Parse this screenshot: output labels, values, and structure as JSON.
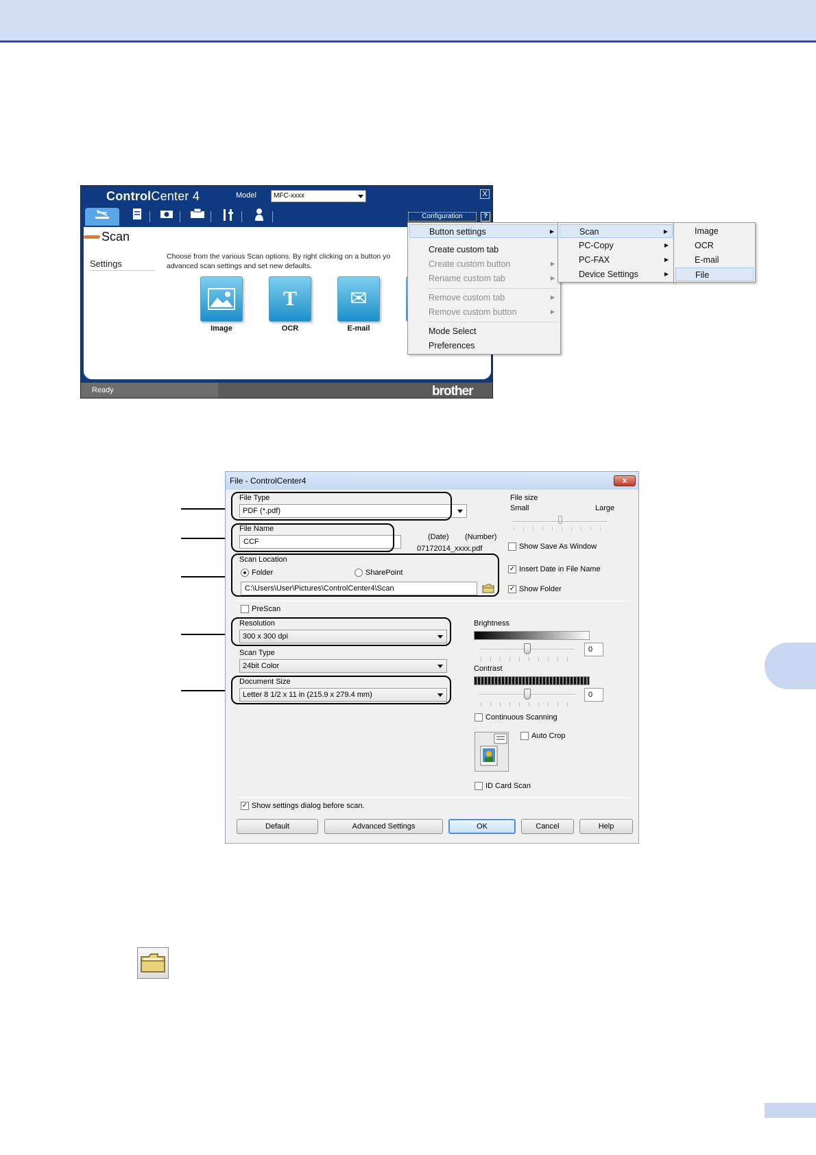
{
  "cc4": {
    "title_bold": "Control",
    "title_rest": "Center 4",
    "model_label": "Model",
    "model_value": "MFC-xxxx",
    "close": "X",
    "configuration": "Configuration",
    "help": "?",
    "section_title": "Scan",
    "settings_label": "Settings",
    "description": "Choose from the various Scan options. By right clicking on a button yo advanced scan settings and set new defaults.",
    "tiles": [
      {
        "label": "Image",
        "glyph": "▣",
        "icon": "image-icon"
      },
      {
        "label": "OCR",
        "glyph": "T",
        "icon": "ocr-icon"
      },
      {
        "label": "E-mail",
        "glyph": "✉",
        "icon": "email-icon"
      }
    ],
    "status": "Ready",
    "brand": "brother"
  },
  "menu1": {
    "items": [
      {
        "label": "Button settings",
        "disabled": false,
        "sub": true
      },
      {
        "label": "Create custom tab",
        "disabled": false,
        "sub": false
      },
      {
        "label": "Create custom button",
        "disabled": true,
        "sub": true
      },
      {
        "label": "Rename custom tab",
        "disabled": true,
        "sub": true
      },
      {
        "label": "Remove custom tab",
        "disabled": true,
        "sub": true
      },
      {
        "label": "Remove custom button",
        "disabled": true,
        "sub": true
      },
      {
        "label": "Mode Select",
        "disabled": false,
        "sub": false
      },
      {
        "label": "Preferences",
        "disabled": false,
        "sub": false
      }
    ]
  },
  "menu2": {
    "items": [
      "Scan",
      "PC-Copy",
      "PC-FAX",
      "Device Settings"
    ]
  },
  "menu3": {
    "items": [
      "Image",
      "OCR",
      "E-mail",
      "File"
    ]
  },
  "dialog": {
    "title": "File - ControlCenter4",
    "close": "x",
    "file_type_label": "File Type",
    "file_type_value": "PDF (*.pdf)",
    "file_size_label": "File size",
    "file_size_small": "Small",
    "file_size_large": "Large",
    "file_name_label": "File Name",
    "file_name_value": "CCF",
    "date_label": "(Date)",
    "number_label": "(Number)",
    "file_name_preview": "07172014_xxxx.pdf",
    "show_save_as": "Show Save As Window",
    "insert_date": "Insert Date in File Name",
    "show_folder": "Show Folder",
    "scan_location_label": "Scan Location",
    "folder_option": "Folder",
    "sharepoint_option": "SharePoint",
    "path_value": "C:\\Users\\User\\Pictures\\ControlCenter4\\Scan",
    "prescan": "PreScan",
    "resolution_label": "Resolution",
    "resolution_value": "300 x 300 dpi",
    "scan_type_label": "Scan Type",
    "scan_type_value": "24bit Color",
    "doc_size_label": "Document Size",
    "doc_size_value": "Letter 8 1/2 x 11 in (215.9 x 279.4 mm)",
    "brightness_label": "Brightness",
    "brightness_value": "0",
    "contrast_label": "Contrast",
    "contrast_value": "0",
    "continuous": "Continuous Scanning",
    "auto_crop": "Auto Crop",
    "id_card": "ID Card Scan",
    "show_settings": "Show settings dialog before scan.",
    "buttons": {
      "default": "Default",
      "advanced": "Advanced Settings",
      "ok": "OK",
      "cancel": "Cancel",
      "help": "Help"
    },
    "checkmark": "✓"
  },
  "colors": {
    "header_band": "#d3dcf5",
    "header_rule": "#1c4fb5",
    "cc4_frame": "#0f3a82",
    "tile_blue": "#1e8ec9"
  }
}
